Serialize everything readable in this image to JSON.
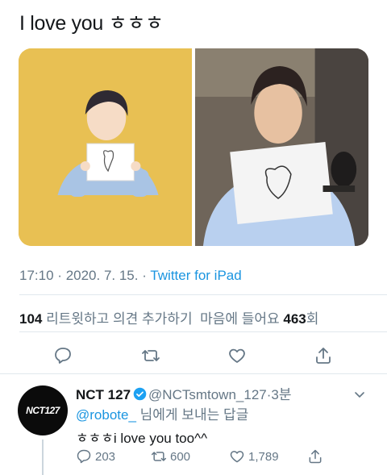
{
  "tweet": {
    "text": "I love you ㅎㅎㅎ",
    "time": "17:10",
    "separator": "·",
    "date": "2020. 7. 15.",
    "separator2": "·",
    "source": "Twitter for iPad"
  },
  "stats": {
    "retweets": "104",
    "retweets_label": "리트윗하고 의견 추가하기",
    "likes_prefix": "마음에 들어요",
    "likes": "463",
    "likes_suffix": "회"
  },
  "actions": [
    "reply-icon",
    "retweet-icon",
    "like-icon",
    "share-icon"
  ],
  "reply": {
    "avatar_text": "NCT127",
    "name": "NCT 127",
    "handle": "@NCTsmtown_127",
    "separator": "·",
    "time": "3분",
    "replying_mention": "@robote_",
    "replying_suffix": "님에게 보내는 답글",
    "text": "ㅎㅎㅎi love you too^^",
    "reply_count": "203",
    "retweet_count": "600",
    "like_count": "1,789"
  },
  "colors": {
    "link": "#1b95e0",
    "muted": "#657786",
    "text": "#14171a",
    "divider": "#e1e8ed"
  }
}
